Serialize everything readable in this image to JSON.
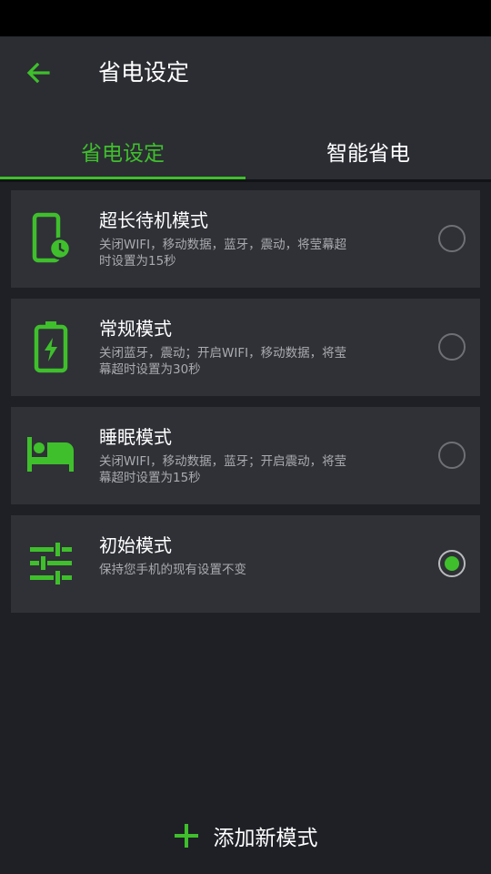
{
  "header": {
    "title": "省电设定"
  },
  "tabs": [
    {
      "label": "省电设定",
      "active": true
    },
    {
      "label": "智能省电",
      "active": false
    }
  ],
  "modes": [
    {
      "title": "超长待机模式",
      "desc": "关闭WIFI，移动数据，蓝牙，震动，将莹幕超时设置为15秒",
      "icon": "phone-clock-icon",
      "selected": false
    },
    {
      "title": "常规模式",
      "desc": "关闭蓝牙，震动；开启WIFI，移动数据，将莹幕超时设置为30秒",
      "icon": "battery-charging-icon",
      "selected": false
    },
    {
      "title": "睡眠模式",
      "desc": "关闭WIFI，移动数据，蓝牙；开启震动，将莹幕超时设置为15秒",
      "icon": "bed-icon",
      "selected": false
    },
    {
      "title": "初始模式",
      "desc": "保持您手机的现有设置不变",
      "icon": "sliders-icon",
      "selected": true
    }
  ],
  "footer": {
    "add_label": "添加新模式"
  },
  "colors": {
    "accent": "#3fbf2c",
    "background": "#1e2026",
    "card": "#2f3137",
    "header": "#2b2d33"
  }
}
